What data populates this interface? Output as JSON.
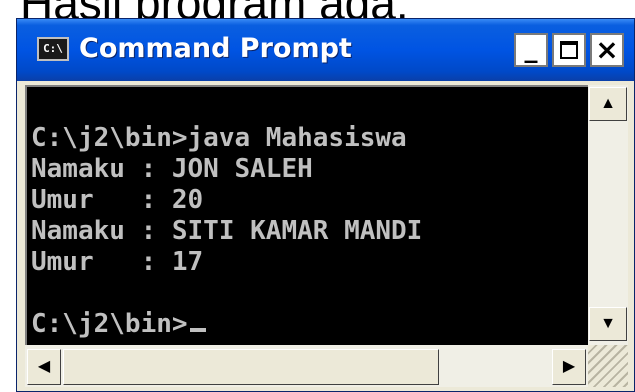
{
  "slide": {
    "caption": "Hasil program ada:"
  },
  "window": {
    "title": "Command Prompt",
    "icon_label": "C:\\",
    "buttons": {
      "minimize": "_",
      "maximize": "□",
      "close": "×"
    }
  },
  "console": {
    "lines": [
      "C:\\j2\\bin>java Mahasiswa",
      "Namaku : JON SALEH",
      "Umur   : 20",
      "Namaku : SITI KAMAR MANDI",
      "Umur   : 17",
      "",
      "C:\\j2\\bin>"
    ]
  },
  "scrollbars": {
    "up": "▲",
    "down": "▼",
    "left": "◀",
    "right": "▶"
  },
  "colors": {
    "titlebar": "#0054e3",
    "console_bg": "#000000",
    "console_text": "#c0c0c0",
    "frame": "#ece9d8"
  }
}
